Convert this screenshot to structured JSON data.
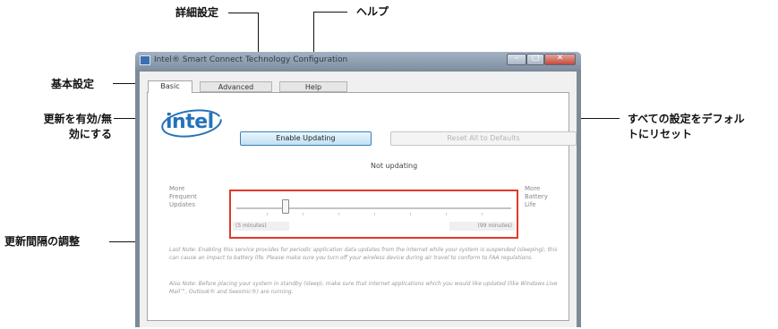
{
  "callouts": {
    "advanced": "詳細設定",
    "help": "ヘルプ",
    "basic": "基本設定",
    "enable_line1": "更新を有効/無",
    "enable_line2": "効にする",
    "reset_line1": "すべての設定をデフォル",
    "reset_line2": "トにリセット",
    "interval": "更新間隔の調整"
  },
  "window": {
    "title": "Intel® Smart Connect Technology Configuration",
    "tabs": [
      "Basic",
      "Advanced",
      "Help"
    ],
    "active_tab": "Basic",
    "logo_text": "intel",
    "enable_button": "Enable Updating",
    "reset_button": "Reset All to Defaults",
    "status": "Not updating",
    "left_label": [
      "More",
      "Frequent",
      "Updates"
    ],
    "right_label": [
      "More",
      "Battery",
      "Life"
    ],
    "slider": {
      "min_label": "(5 minutes)",
      "max_label": "(99 minutes)",
      "value_fraction": 0.17
    },
    "note1": "Last Note: Enabling this service provides for periodic application data updates from the internet while your system is suspended (sleeping); this can cause an impact to battery life. Please make sure you turn off your wireless device during air travel to conform to FAA regulations.",
    "note2": "Also Note: Before placing your system in standby (sleep), make sure that internet applications which you would like updated (like Windows Live Mail™, Outlook® and Seesmic®) are running."
  },
  "colors": {
    "accent": "#2473b9",
    "highlight": "#e2382b"
  }
}
